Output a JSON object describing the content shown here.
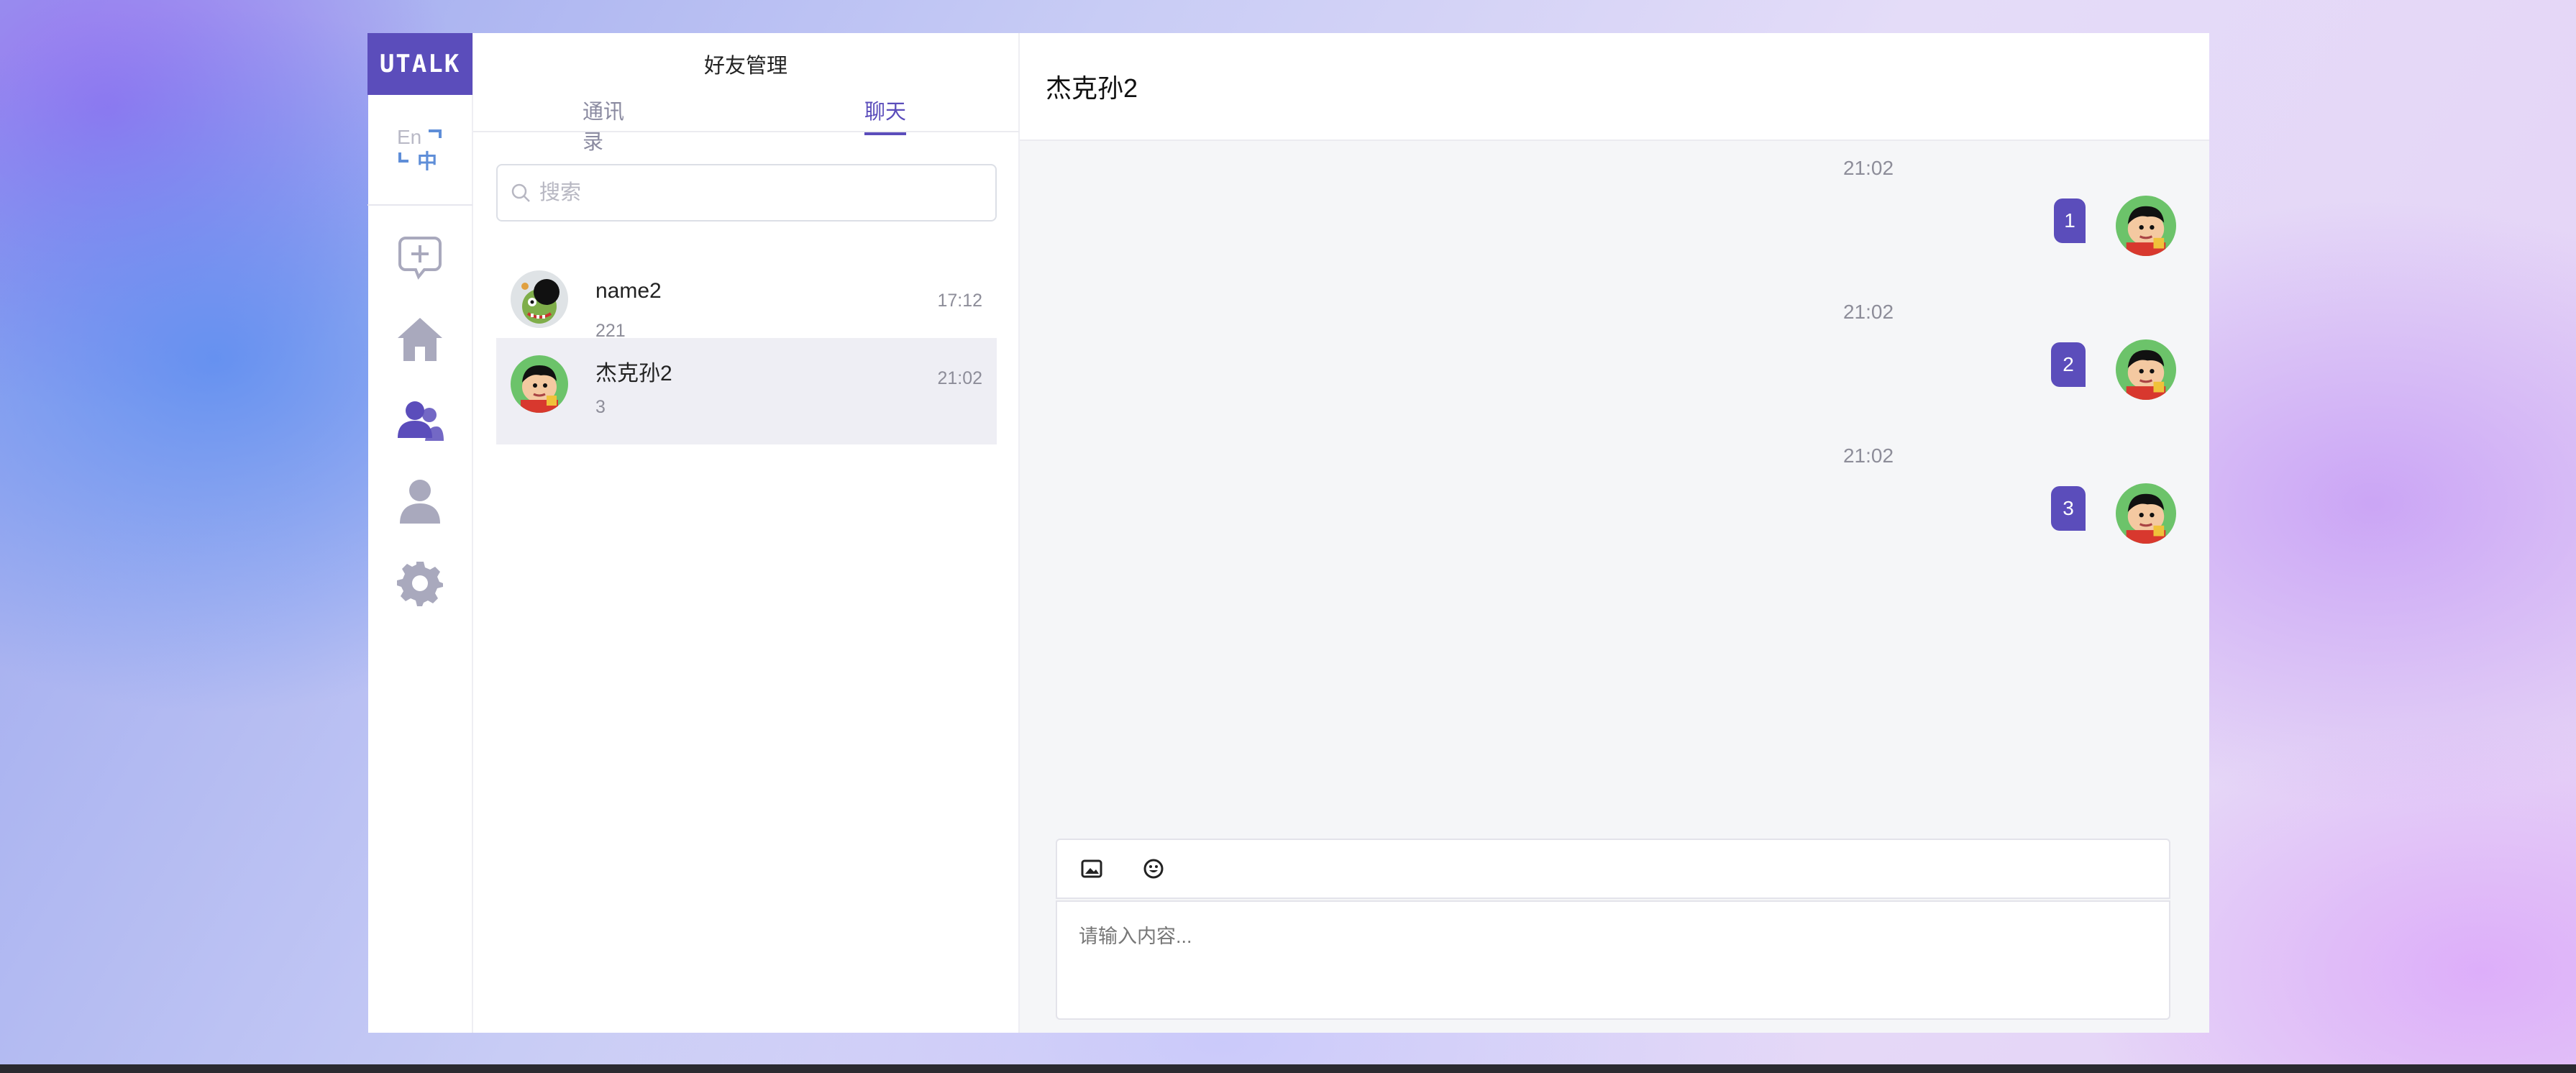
{
  "app": {
    "logo_text": "UTALK",
    "lang_toggle": {
      "en": "En",
      "zh": "中"
    },
    "nav_icons": [
      "add-chat-icon",
      "home-icon",
      "friends-icon",
      "user-icon",
      "settings-icon"
    ],
    "accent_color": "#5b4dbb"
  },
  "panel": {
    "title": "好友管理",
    "tabs": [
      {
        "label": "通讯录",
        "active": false
      },
      {
        "label": "聊天",
        "active": true
      }
    ],
    "search_placeholder": "搜索",
    "chats": [
      {
        "name": "name2",
        "preview": "221",
        "time": "17:12",
        "selected": false,
        "avatar": "zombie-cartoon-avatar"
      },
      {
        "name": "杰克孙2",
        "preview": "3",
        "time": "21:02",
        "selected": true,
        "avatar": "shinchan-avatar"
      }
    ]
  },
  "conversation": {
    "title": "杰克孙2",
    "messages": [
      {
        "time": "21:02",
        "text": "1",
        "from_self": true
      },
      {
        "time": "21:02",
        "text": "2",
        "from_self": true
      },
      {
        "time": "21:02",
        "text": "3",
        "from_self": true
      }
    ],
    "toolbar_icons": [
      "image-icon",
      "emoji-icon"
    ],
    "input_placeholder": "请输入内容..."
  }
}
